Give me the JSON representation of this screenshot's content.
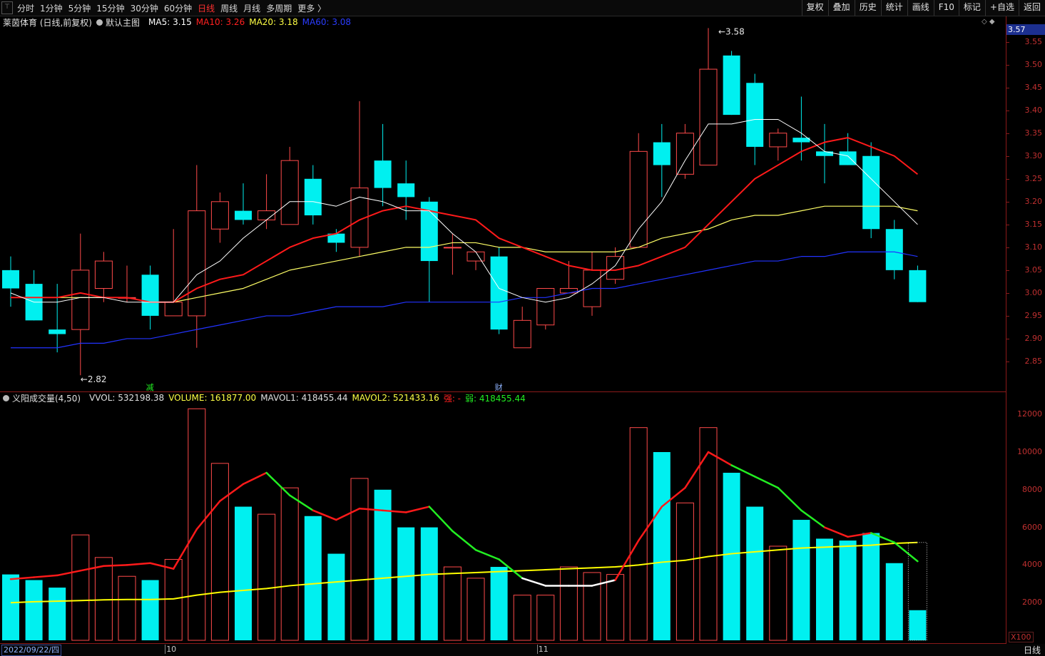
{
  "toolbar": {
    "pin_label": "⊤",
    "periods": [
      "分时",
      "1分钟",
      "5分钟",
      "15分钟",
      "30分钟",
      "60分钟",
      "日线",
      "周线",
      "月线",
      "多周期",
      "更多 〉"
    ],
    "active_period": "日线",
    "right_buttons": [
      "复权",
      "叠加",
      "历史",
      "统计",
      "画线",
      "F10",
      "标记",
      "+自选",
      "返回"
    ]
  },
  "main_legend": {
    "stock": "莱茵体育 (日线,前复权)",
    "template": "默认主图",
    "ma5": "MA5: 3.15",
    "ma10": "MA10: 3.26",
    "ma20": "MA20: 3.18",
    "ma60": "MA60: 3.08"
  },
  "volume_legend": {
    "indicator": "义阳成交量(4,50)",
    "vvol": "VVOL: 532198.38",
    "volume": "VOLUME: 161877.00",
    "mavol1": "MAVOL1: 418455.44",
    "mavol2": "MAVOL2: 521433.16",
    "strong": "强: -",
    "weak": "弱: 418455.44"
  },
  "price_tag": "3.57",
  "diamond_icons": "◇ ◆",
  "high_label": "3.58",
  "low_label": "2.82",
  "event_markers": [
    {
      "label": "减",
      "index": 6
    },
    {
      "label": "财",
      "index": 21
    }
  ],
  "price_axis": [
    "3.55",
    "3.50",
    "3.45",
    "3.40",
    "3.35",
    "3.30",
    "3.25",
    "3.20",
    "3.15",
    "3.10",
    "3.05",
    "3.00",
    "2.95",
    "2.90",
    "2.85"
  ],
  "volume_axis": [
    "12000",
    "10000",
    "8000",
    "6000",
    "4000",
    "2000"
  ],
  "volume_unit": "X100",
  "date_start": "2022/09/22/四",
  "month_marks": [
    {
      "label": "10",
      "index": 7
    },
    {
      "label": "11",
      "index": 23
    }
  ],
  "bottom_period": "日线",
  "colors": {
    "up": "#ff4a4a",
    "down": "#00f0f0",
    "ma5": "#ffffff",
    "ma10": "#ff1a1a",
    "ma20": "#ffff66",
    "ma60": "#2233ff",
    "vol_ma_long": "#ffff00",
    "strong": "#ff1a1a",
    "weak": "#22ee22",
    "neutral": "#ffffff"
  },
  "chart_data": {
    "type": "candlestick",
    "ylim": [
      2.8,
      3.59
    ],
    "candles": [
      {
        "o": 3.05,
        "h": 3.08,
        "l": 2.97,
        "c": 3.01
      },
      {
        "o": 3.02,
        "h": 3.05,
        "l": 2.94,
        "c": 2.94
      },
      {
        "o": 2.92,
        "h": 3.02,
        "l": 2.87,
        "c": 2.91
      },
      {
        "o": 2.92,
        "h": 3.13,
        "l": 2.82,
        "c": 3.05
      },
      {
        "o": 3.01,
        "h": 3.09,
        "l": 2.98,
        "c": 3.07
      },
      {
        "o": 2.99,
        "h": 3.06,
        "l": 2.98,
        "c": 2.99
      },
      {
        "o": 3.04,
        "h": 3.06,
        "l": 2.92,
        "c": 2.95
      },
      {
        "o": 2.95,
        "h": 3.14,
        "l": 2.95,
        "c": 2.98
      },
      {
        "o": 2.95,
        "h": 3.28,
        "l": 2.88,
        "c": 3.18
      },
      {
        "o": 3.14,
        "h": 3.22,
        "l": 3.11,
        "c": 3.2
      },
      {
        "o": 3.18,
        "h": 3.24,
        "l": 3.15,
        "c": 3.16
      },
      {
        "o": 3.16,
        "h": 3.26,
        "l": 3.14,
        "c": 3.18
      },
      {
        "o": 3.15,
        "h": 3.32,
        "l": 3.15,
        "c": 3.29
      },
      {
        "o": 3.25,
        "h": 3.28,
        "l": 3.15,
        "c": 3.17
      },
      {
        "o": 3.13,
        "h": 3.14,
        "l": 3.09,
        "c": 3.11
      },
      {
        "o": 3.1,
        "h": 3.42,
        "l": 3.08,
        "c": 3.23
      },
      {
        "o": 3.29,
        "h": 3.37,
        "l": 3.19,
        "c": 3.23
      },
      {
        "o": 3.24,
        "h": 3.29,
        "l": 3.16,
        "c": 3.21
      },
      {
        "o": 3.2,
        "h": 3.21,
        "l": 2.98,
        "c": 3.07
      },
      {
        "o": 3.1,
        "h": 3.13,
        "l": 3.04,
        "c": 3.1
      },
      {
        "o": 3.07,
        "h": 3.08,
        "l": 3.05,
        "c": 3.09
      },
      {
        "o": 3.08,
        "h": 3.1,
        "l": 2.91,
        "c": 2.92
      },
      {
        "o": 2.88,
        "h": 2.97,
        "l": 2.88,
        "c": 2.94
      },
      {
        "o": 2.93,
        "h": 3.01,
        "l": 2.92,
        "c": 3.01
      },
      {
        "o": 3.0,
        "h": 3.07,
        "l": 3.0,
        "c": 3.01
      },
      {
        "o": 2.97,
        "h": 3.09,
        "l": 2.95,
        "c": 3.05
      },
      {
        "o": 3.03,
        "h": 3.1,
        "l": 3.02,
        "c": 3.08
      },
      {
        "o": 3.1,
        "h": 3.35,
        "l": 3.1,
        "c": 3.31
      },
      {
        "o": 3.33,
        "h": 3.37,
        "l": 3.21,
        "c": 3.28
      },
      {
        "o": 3.26,
        "h": 3.37,
        "l": 3.25,
        "c": 3.35
      },
      {
        "o": 3.28,
        "h": 3.58,
        "l": 3.28,
        "c": 3.49
      },
      {
        "o": 3.52,
        "h": 3.53,
        "l": 3.39,
        "c": 3.39
      },
      {
        "o": 3.46,
        "h": 3.48,
        "l": 3.28,
        "c": 3.32
      },
      {
        "o": 3.32,
        "h": 3.36,
        "l": 3.29,
        "c": 3.35
      },
      {
        "o": 3.34,
        "h": 3.43,
        "l": 3.29,
        "c": 3.33
      },
      {
        "o": 3.31,
        "h": 3.37,
        "l": 3.24,
        "c": 3.3
      },
      {
        "o": 3.31,
        "h": 3.35,
        "l": 3.28,
        "c": 3.28
      },
      {
        "o": 3.3,
        "h": 3.33,
        "l": 3.12,
        "c": 3.14
      },
      {
        "o": 3.14,
        "h": 3.16,
        "l": 3.03,
        "c": 3.05
      },
      {
        "o": 3.05,
        "h": 3.06,
        "l": 2.98,
        "c": 2.98
      }
    ],
    "ma5": [
      3.0,
      2.98,
      2.98,
      2.99,
      2.99,
      2.98,
      2.98,
      2.98,
      3.04,
      3.07,
      3.12,
      3.16,
      3.2,
      3.2,
      3.19,
      3.21,
      3.2,
      3.18,
      3.18,
      3.13,
      3.09,
      3.01,
      2.99,
      2.98,
      2.99,
      3.02,
      3.06,
      3.14,
      3.2,
      3.29,
      3.37,
      3.37,
      3.38,
      3.38,
      3.35,
      3.31,
      3.3,
      3.25,
      3.2,
      3.15
    ],
    "ma10": [
      2.99,
      2.99,
      2.99,
      3.0,
      2.99,
      2.99,
      2.98,
      2.98,
      3.01,
      3.03,
      3.04,
      3.07,
      3.1,
      3.12,
      3.13,
      3.16,
      3.18,
      3.19,
      3.18,
      3.17,
      3.16,
      3.12,
      3.1,
      3.08,
      3.06,
      3.05,
      3.05,
      3.06,
      3.08,
      3.1,
      3.15,
      3.2,
      3.25,
      3.28,
      3.31,
      3.33,
      3.34,
      3.32,
      3.3,
      3.26
    ],
    "ma20": [
      2.99,
      2.99,
      2.99,
      2.99,
      2.99,
      2.99,
      2.98,
      2.98,
      2.99,
      3.0,
      3.01,
      3.03,
      3.05,
      3.06,
      3.07,
      3.08,
      3.09,
      3.1,
      3.1,
      3.11,
      3.11,
      3.1,
      3.1,
      3.09,
      3.09,
      3.09,
      3.09,
      3.1,
      3.12,
      3.13,
      3.14,
      3.16,
      3.17,
      3.17,
      3.18,
      3.19,
      3.19,
      3.19,
      3.19,
      3.18
    ],
    "ma60": [
      2.88,
      2.88,
      2.88,
      2.89,
      2.89,
      2.9,
      2.9,
      2.91,
      2.92,
      2.93,
      2.94,
      2.95,
      2.95,
      2.96,
      2.97,
      2.97,
      2.97,
      2.98,
      2.98,
      2.98,
      2.98,
      2.98,
      2.99,
      2.99,
      3.0,
      3.01,
      3.01,
      3.02,
      3.03,
      3.04,
      3.05,
      3.06,
      3.07,
      3.07,
      3.08,
      3.08,
      3.09,
      3.09,
      3.09,
      3.08
    ],
    "volume": {
      "ylim": [
        0,
        12500
      ],
      "values": [
        3500,
        3200,
        2800,
        5600,
        4400,
        3400,
        3200,
        4300,
        12300,
        9400,
        7100,
        6700,
        8100,
        6600,
        4600,
        8600,
        8000,
        6000,
        6000,
        3900,
        3300,
        3900,
        2400,
        2400,
        3900,
        3600,
        3500,
        11300,
        10000,
        7300,
        11300,
        8900,
        7100,
        5000,
        6400,
        5400,
        5300,
        5700,
        4100,
        1600
      ],
      "mavol1": [
        3250,
        3350,
        3450,
        3700,
        3950,
        4000,
        4100,
        3800,
        5900,
        7400,
        8300,
        8900,
        7700,
        6900,
        6400,
        7000,
        6900,
        6800,
        7100,
        5800,
        4800,
        4300,
        3300,
        2900,
        2900,
        2900,
        3200,
        5300,
        7100,
        8100,
        10000,
        9300,
        8700,
        8100,
        6900,
        6000,
        5500,
        5700,
        5200,
        4200
      ],
      "mavol2": [
        2000,
        2050,
        2080,
        2110,
        2150,
        2170,
        2170,
        2200,
        2400,
        2550,
        2650,
        2750,
        2900,
        3000,
        3100,
        3200,
        3300,
        3400,
        3500,
        3550,
        3600,
        3650,
        3700,
        3750,
        3800,
        3850,
        3900,
        4000,
        4150,
        4250,
        4450,
        4600,
        4700,
        4800,
        4900,
        4950,
        5000,
        5050,
        5150,
        5200
      ],
      "mavol1_state": [
        "s",
        "s",
        "s",
        "s",
        "s",
        "s",
        "s",
        "s",
        "s",
        "s",
        "s",
        "s",
        "w",
        "w",
        "s",
        "s",
        "s",
        "s",
        "s",
        "w",
        "w",
        "w",
        "w",
        "n",
        "n",
        "n",
        "n",
        "s",
        "s",
        "s",
        "s",
        "s",
        "w",
        "w",
        "w",
        "w",
        "s",
        "s",
        "w",
        "w"
      ]
    }
  }
}
